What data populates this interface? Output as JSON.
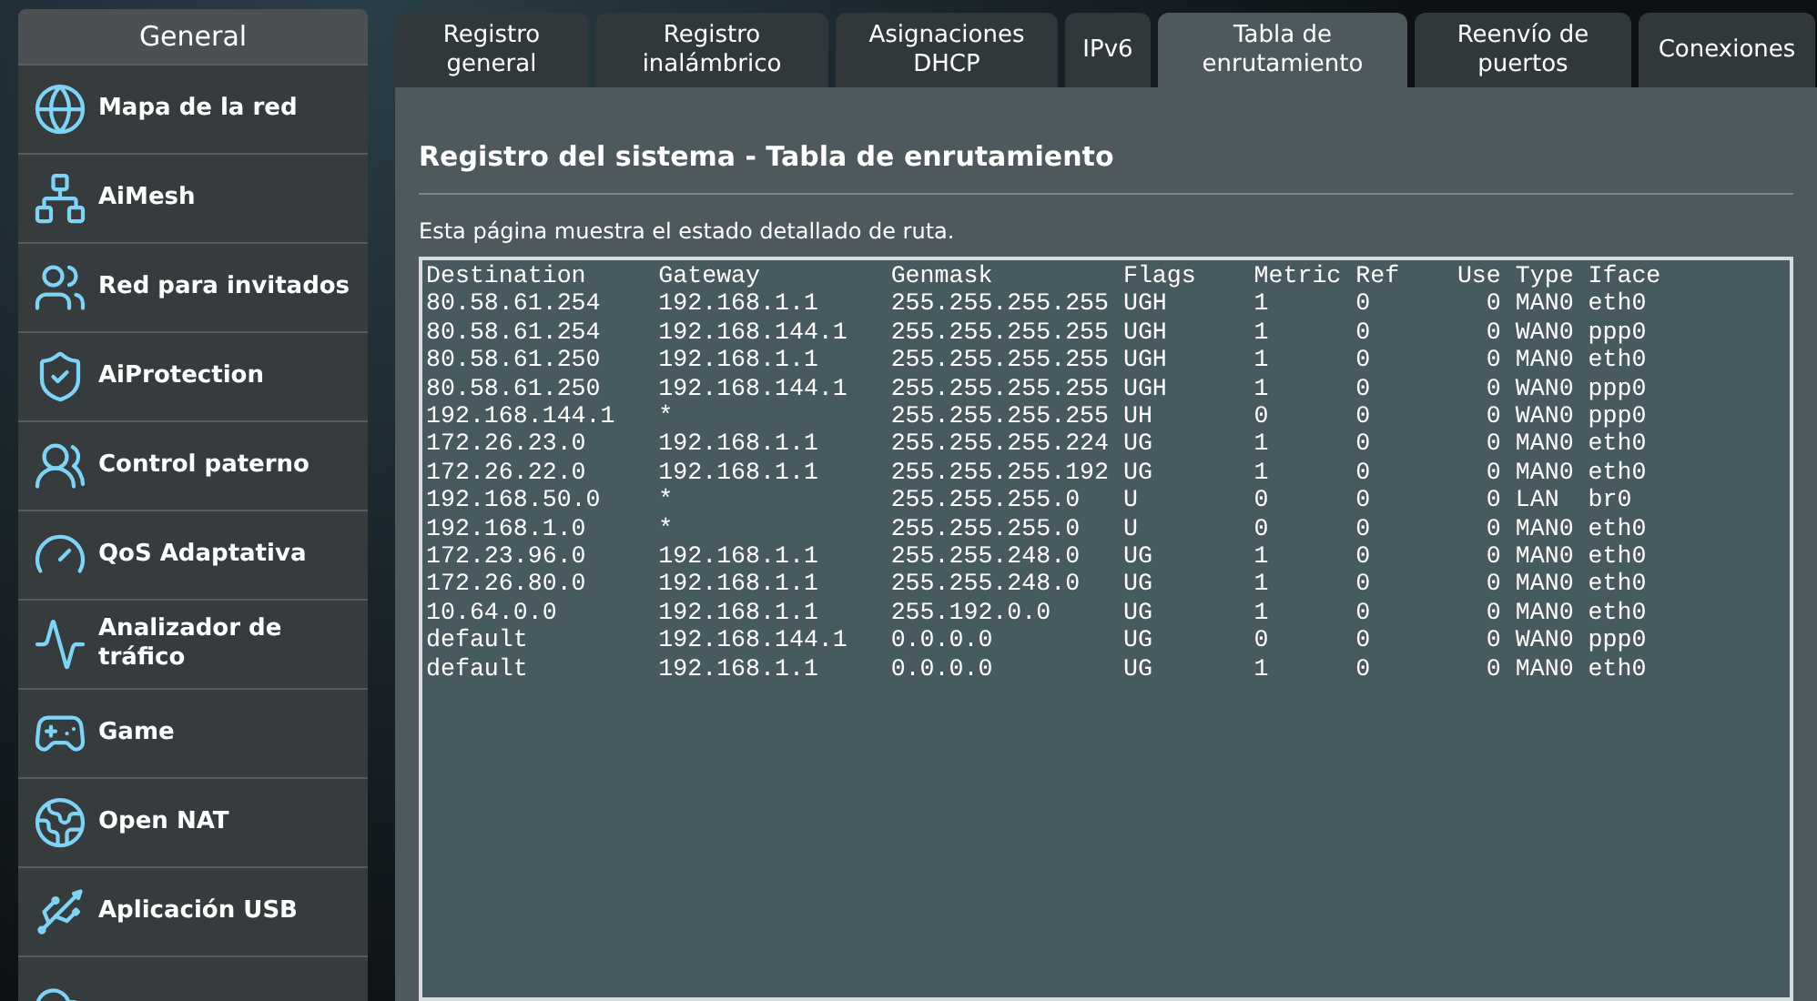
{
  "sidebar": {
    "header": "General",
    "items": [
      {
        "label": "Mapa de la red"
      },
      {
        "label": "AiMesh"
      },
      {
        "label": "Red para invitados"
      },
      {
        "label": "AiProtection"
      },
      {
        "label": "Control paterno"
      },
      {
        "label": "QoS Adaptativa"
      },
      {
        "label": "Analizador de tráfico"
      },
      {
        "label": "Game"
      },
      {
        "label": "Open NAT"
      },
      {
        "label": "Aplicación USB"
      }
    ]
  },
  "tabs": [
    {
      "label": "Registro general",
      "selected": false
    },
    {
      "label": "Registro inalámbrico",
      "selected": false
    },
    {
      "label": "Asignaciones DHCP",
      "selected": false
    },
    {
      "label": "IPv6",
      "selected": false
    },
    {
      "label": "Tabla de enrutamiento",
      "selected": true
    },
    {
      "label": "Reenvío de puertos",
      "selected": false
    },
    {
      "label": "Conexiones",
      "selected": false
    }
  ],
  "page": {
    "title": "Registro del sistema - Tabla de enrutamiento",
    "description": "Esta página muestra el estado detallado de ruta."
  },
  "table": {
    "columns": [
      "Destination",
      "Gateway",
      "Genmask",
      "Flags",
      "Metric",
      "Ref",
      "Use",
      "Type",
      "Iface"
    ],
    "rows": [
      [
        "80.58.61.254",
        "192.168.1.1",
        "255.255.255.255",
        "UGH",
        "1",
        "0",
        "0",
        "MAN0",
        "eth0"
      ],
      [
        "80.58.61.254",
        "192.168.144.1",
        "255.255.255.255",
        "UGH",
        "1",
        "0",
        "0",
        "WAN0",
        "ppp0"
      ],
      [
        "80.58.61.250",
        "192.168.1.1",
        "255.255.255.255",
        "UGH",
        "1",
        "0",
        "0",
        "MAN0",
        "eth0"
      ],
      [
        "80.58.61.250",
        "192.168.144.1",
        "255.255.255.255",
        "UGH",
        "1",
        "0",
        "0",
        "WAN0",
        "ppp0"
      ],
      [
        "192.168.144.1",
        "*",
        "255.255.255.255",
        "UH",
        "0",
        "0",
        "0",
        "WAN0",
        "ppp0"
      ],
      [
        "172.26.23.0",
        "192.168.1.1",
        "255.255.255.224",
        "UG",
        "1",
        "0",
        "0",
        "MAN0",
        "eth0"
      ],
      [
        "172.26.22.0",
        "192.168.1.1",
        "255.255.255.192",
        "UG",
        "1",
        "0",
        "0",
        "MAN0",
        "eth0"
      ],
      [
        "192.168.50.0",
        "*",
        "255.255.255.0",
        "U",
        "0",
        "0",
        "0",
        "LAN",
        "br0"
      ],
      [
        "192.168.1.0",
        "*",
        "255.255.255.0",
        "U",
        "0",
        "0",
        "0",
        "MAN0",
        "eth0"
      ],
      [
        "172.23.96.0",
        "192.168.1.1",
        "255.255.248.0",
        "UG",
        "1",
        "0",
        "0",
        "MAN0",
        "eth0"
      ],
      [
        "172.26.80.0",
        "192.168.1.1",
        "255.255.248.0",
        "UG",
        "1",
        "0",
        "0",
        "MAN0",
        "eth0"
      ],
      [
        "10.64.0.0",
        "192.168.1.1",
        "255.192.0.0",
        "UG",
        "1",
        "0",
        "0",
        "MAN0",
        "eth0"
      ],
      [
        "default",
        "192.168.144.1",
        "0.0.0.0",
        "UG",
        "0",
        "0",
        "0",
        "WAN0",
        "ppp0"
      ],
      [
        "default",
        "192.168.1.1",
        "0.0.0.0",
        "UG",
        "1",
        "0",
        "0",
        "MAN0",
        "eth0"
      ]
    ]
  }
}
